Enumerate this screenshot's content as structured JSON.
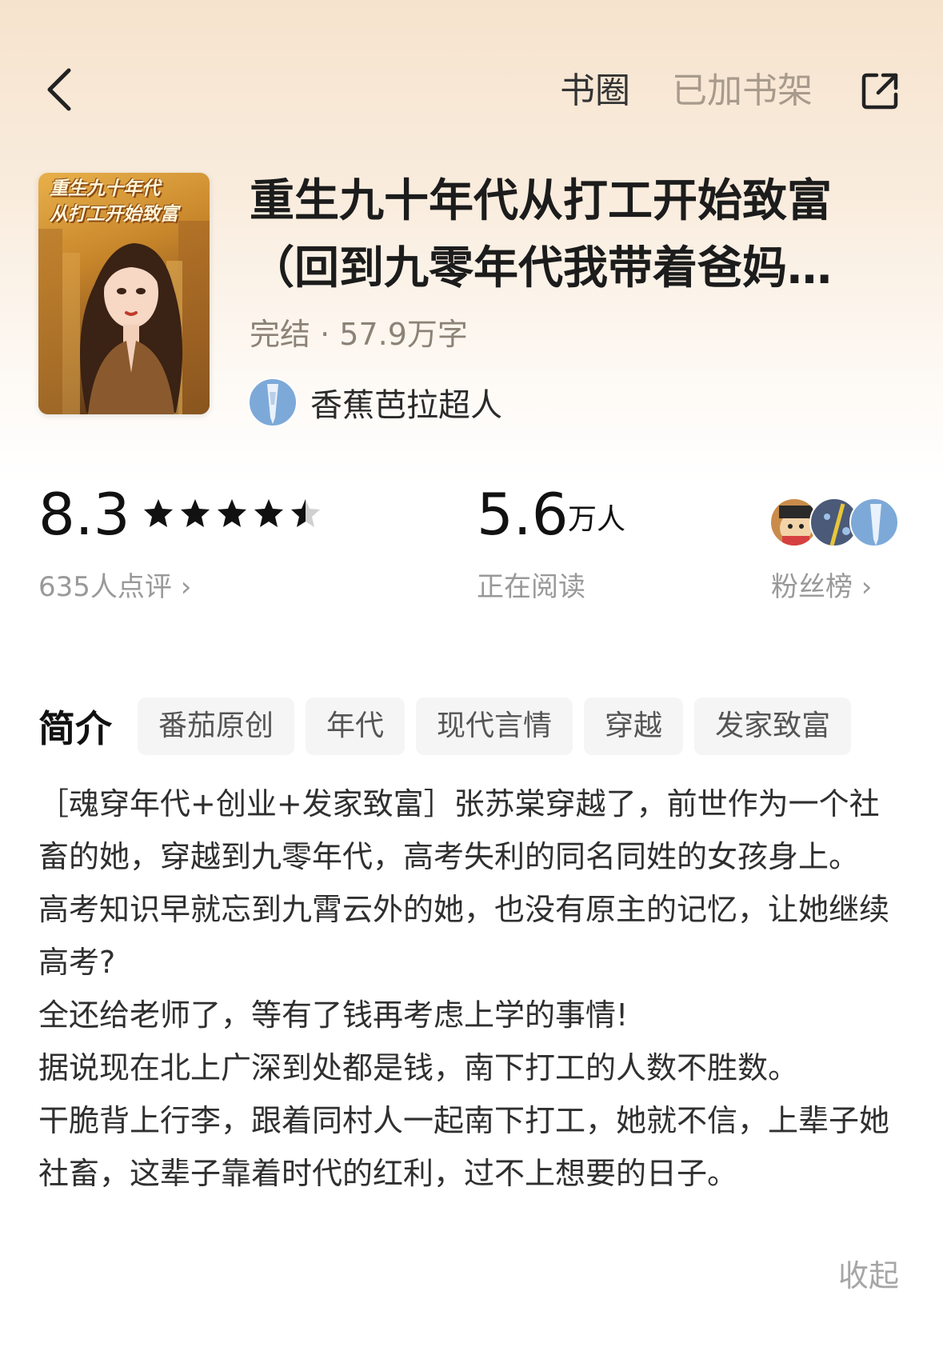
{
  "header": {
    "circle_label": "书圈",
    "shelf_label": "已加书架"
  },
  "book": {
    "cover_title_line1": "重生九十年代",
    "cover_title_line2": "从打工开始致富",
    "title_line1": "重生九十年代从打工开始致富",
    "title_line2": "（回到九零年代我带着爸妈…",
    "status": "完结",
    "separator": " · ",
    "word_count": "57.9万字",
    "author": "香蕉芭拉超人"
  },
  "stats": {
    "score": "8.3",
    "rating_stars": 4.5,
    "rating_max": 5,
    "reviews_label": "635人点评 ›",
    "readers_number": "5.6",
    "readers_unit": "万人",
    "readers_label": "正在阅读",
    "fans_label": "粉丝榜 ›"
  },
  "intro": {
    "title": "简介",
    "tags": [
      "番茄原创",
      "年代",
      "现代言情",
      "穿越",
      "发家致富"
    ],
    "paragraphs": [
      "［魂穿年代+创业+发家致富］张苏棠穿越了，前世作为一个社畜的她，穿越到九零年代，高考失利的同名同姓的女孩身上。",
      "高考知识早就忘到九霄云外的她，也没有原主的记忆，让她继续高考?",
      "全还给老师了，等有了钱再考虑上学的事情!",
      "据说现在北上广深到处都是钱，南下打工的人数不胜数。",
      "干脆背上行李，跟着同村人一起南下打工，她就不信，上辈子她社畜，这辈子靠着时代的红利，过不上想要的日子。"
    ],
    "collapse_label": "收起"
  },
  "colors": {
    "hero_top": "#f6e3cd",
    "muted_text": "#999999",
    "tag_bg": "#f5f5f5"
  },
  "icons": {
    "back": "chevron-left-icon",
    "share": "share-icon",
    "star": "star-icon"
  }
}
